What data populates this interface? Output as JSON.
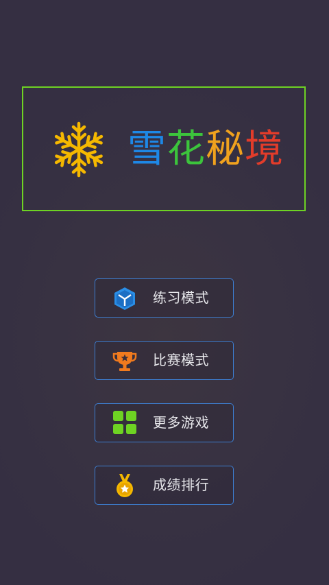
{
  "app": {
    "title_chars": [
      {
        "char": "雪",
        "color": "#1e88e6"
      },
      {
        "char": "花",
        "color": "#3cc43c"
      },
      {
        "char": "秘",
        "color": "#f0a21e"
      },
      {
        "char": "境",
        "color": "#e23c2a"
      }
    ],
    "colors": {
      "frame_border": "#6ed323",
      "snowflake": "#f5b800",
      "button_border": "#3d7fd3",
      "background": "#383242"
    }
  },
  "menu": {
    "items": [
      {
        "label": "练习模式",
        "icon": "cube-icon",
        "icon_color": "#2a8ee6"
      },
      {
        "label": "比赛模式",
        "icon": "trophy-icon",
        "icon_color": "#f07a1e"
      },
      {
        "label": "更多游戏",
        "icon": "grid-icon",
        "icon_color": "#6ed323"
      },
      {
        "label": "成绩排行",
        "icon": "medal-icon",
        "icon_color": "#f5b800"
      }
    ]
  }
}
